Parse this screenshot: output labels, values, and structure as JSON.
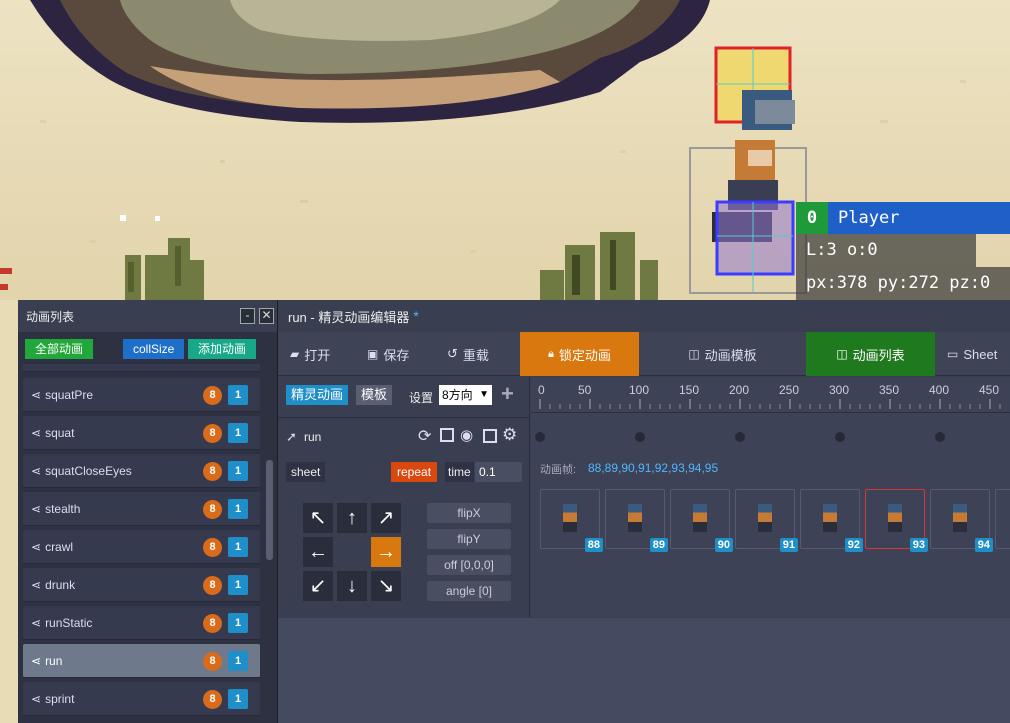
{
  "hud": {
    "player_id": "0",
    "player_name": "Player",
    "line2": "L:3 o:0",
    "line3": "px:378 py:272 pz:0"
  },
  "left_panel": {
    "title": "动画列表",
    "min_label": "-",
    "close_label": "✕",
    "btn_all": "全部动画",
    "btn_collsize": "collSize",
    "btn_add": "添加动画",
    "items": [
      {
        "label": "squatPre",
        "badge_a": "8",
        "badge_b": "1"
      },
      {
        "label": "squat",
        "badge_a": "8",
        "badge_b": "1"
      },
      {
        "label": "squatCloseEyes",
        "badge_a": "8",
        "badge_b": "1"
      },
      {
        "label": "stealth",
        "badge_a": "8",
        "badge_b": "1"
      },
      {
        "label": "crawl",
        "badge_a": "8",
        "badge_b": "1"
      },
      {
        "label": "drunk",
        "badge_a": "8",
        "badge_b": "1"
      },
      {
        "label": "runStatic",
        "badge_a": "8",
        "badge_b": "1"
      },
      {
        "label": "run",
        "badge_a": "8",
        "badge_b": "1"
      },
      {
        "label": "sprint",
        "badge_a": "8",
        "badge_b": "1"
      }
    ],
    "selected_index": 7
  },
  "editor": {
    "title": "run - 精灵动画编辑器",
    "modified_mark": "*",
    "toolbar": {
      "open": "打开",
      "save": "保存",
      "reload": "重载",
      "lock": "锁定动画",
      "templates": "动画模板",
      "anim_list": "动画列表",
      "sheet": "Sheet"
    },
    "tabs": {
      "sprite": "精灵动画",
      "template": "模板"
    },
    "settings_label": "设置",
    "direction_select": "8方向",
    "add_label": "+",
    "anim_name": "run",
    "sheet_label": "sheet",
    "repeat_label": "repeat",
    "time_label": "time",
    "time_value": "0.1",
    "flipx": "flipX",
    "flipy": "flipY",
    "off": "off [0,0,0]",
    "angle": "angle [0]",
    "frames_label": "动画帧:",
    "frames_value": "88,89,90,91,92,93,94,95",
    "ruler": [
      "0",
      "50",
      "100",
      "150",
      "200",
      "250",
      "300",
      "350",
      "400",
      "450"
    ],
    "frames": [
      "88",
      "89",
      "90",
      "91",
      "92",
      "93",
      "94"
    ],
    "selected_frame": "93",
    "direction_arrows": [
      "↖",
      "↑",
      "↗",
      "←",
      "→",
      "↙",
      "↓",
      "↘"
    ],
    "active_direction": "→"
  },
  "colors": {
    "accent_orange": "#d96b1a",
    "accent_blue": "#1e8fc9",
    "accent_green": "#22a83a",
    "lock_orange": "#d9780e"
  }
}
